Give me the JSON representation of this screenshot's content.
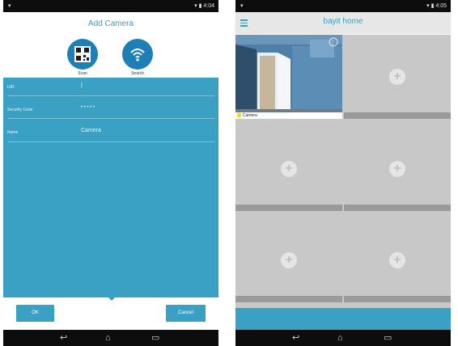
{
  "left_screen": {
    "status": {
      "left": "▾",
      "right": "▾ ▮ 4:04"
    },
    "title": "Add Camera",
    "actions": [
      {
        "label": "Scan",
        "icon": "qr-code-icon"
      },
      {
        "label": "Search",
        "icon": "wifi-icon"
      }
    ],
    "fields": [
      {
        "label": "UID",
        "value": "|"
      },
      {
        "label": "Security Code",
        "value": "• • • • •"
      },
      {
        "label": "Name",
        "value": "Camera"
      }
    ],
    "buttons": {
      "ok": "OK",
      "cancel": "Cancel"
    },
    "nav": {
      "back": "↩",
      "home": "⌂",
      "recents": "▭"
    }
  },
  "right_screen": {
    "status": {
      "left": "▾",
      "right": "▾ ▮ 4:05"
    },
    "logo": "bayit home",
    "camera": {
      "name": "Camera",
      "status_color": "#e8e21a"
    },
    "empty_tile_symbol": "+",
    "nav": {
      "back": "↩",
      "home": "⌂",
      "recents": "▭"
    }
  },
  "colors": {
    "accent": "#3aa0c4",
    "dark_blue": "#1d7fb6",
    "tile": "#c8c8c8"
  }
}
